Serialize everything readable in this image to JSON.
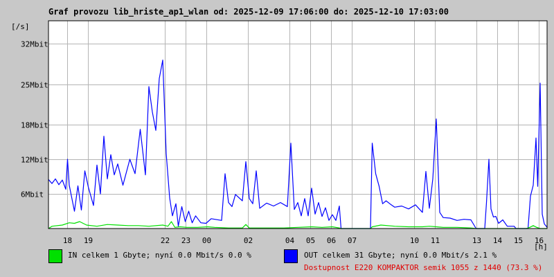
{
  "title": "Graf provozu lib_hriste_ap1_wlan od: 2025-12-09 17:06:00 do: 2025-12-10 17:03:00",
  "y_unit": "[/s]",
  "x_unit": "[h]",
  "colors": {
    "in": "#00e000",
    "out": "#0000ff",
    "grid": "#b4b4b4",
    "availability": "#e00000"
  },
  "legend": {
    "in_text": "IN celkem 1 Gbyte; nyní   0.0 Mbit/s 0.0 %",
    "out_text": "OUT celkem 31 Gbyte; nyní   0.0 Mbit/s 2.1 %"
  },
  "availability": "Dostupnost E220 KOMPAKTOR semik 1055 z 1440 (73.3 %)",
  "chart_data": {
    "type": "line",
    "y_unit": "Mbit/s",
    "ylim": [
      0,
      36
    ],
    "y_ticks": [
      {
        "value": 6,
        "label": "6Mbit"
      },
      {
        "value": 12,
        "label": "12Mbit"
      },
      {
        "value": 18,
        "label": "18Mbit"
      },
      {
        "value": 25,
        "label": "25Mbit"
      },
      {
        "value": 32,
        "label": "32Mbit"
      }
    ],
    "x_range_minutes": [
      0,
      1440
    ],
    "x_ticks": [
      {
        "t": 54,
        "label": "18"
      },
      {
        "t": 114,
        "label": "19"
      },
      {
        "t": 336,
        "label": "22"
      },
      {
        "t": 396,
        "label": "23"
      },
      {
        "t": 456,
        "label": "00"
      },
      {
        "t": 576,
        "label": "02"
      },
      {
        "t": 696,
        "label": "04"
      },
      {
        "t": 756,
        "label": "05"
      },
      {
        "t": 816,
        "label": "06"
      },
      {
        "t": 876,
        "label": "07"
      },
      {
        "t": 1056,
        "label": "10"
      },
      {
        "t": 1116,
        "label": "11"
      },
      {
        "t": 1236,
        "label": "13"
      },
      {
        "t": 1296,
        "label": "14"
      },
      {
        "t": 1356,
        "label": "15"
      },
      {
        "t": 1416,
        "label": "16"
      }
    ],
    "series": [
      {
        "name": "IN",
        "points": [
          [
            0,
            0
          ],
          [
            10,
            0.4
          ],
          [
            40,
            0.6
          ],
          [
            60,
            1.0
          ],
          [
            75,
            0.9
          ],
          [
            90,
            1.2
          ],
          [
            110,
            0.6
          ],
          [
            140,
            0.4
          ],
          [
            170,
            0.7
          ],
          [
            200,
            0.6
          ],
          [
            230,
            0.5
          ],
          [
            260,
            0.5
          ],
          [
            290,
            0.4
          ],
          [
            330,
            0.6
          ],
          [
            345,
            0.4
          ],
          [
            355,
            1.2
          ],
          [
            365,
            0.2
          ],
          [
            380,
            0.3
          ],
          [
            400,
            0.2
          ],
          [
            430,
            0.2
          ],
          [
            460,
            0.3
          ],
          [
            480,
            0.2
          ],
          [
            520,
            0.1
          ],
          [
            560,
            0.1
          ],
          [
            570,
            0.7
          ],
          [
            580,
            0.1
          ],
          [
            620,
            0.1
          ],
          [
            680,
            0.1
          ],
          [
            720,
            0.2
          ],
          [
            760,
            0.3
          ],
          [
            790,
            0.2
          ],
          [
            820,
            0.3
          ],
          [
            840,
            0.1
          ],
          [
            845,
            0
          ],
          [
            930,
            0
          ],
          [
            935,
            0.3
          ],
          [
            960,
            0.6
          ],
          [
            1000,
            0.4
          ],
          [
            1040,
            0.3
          ],
          [
            1080,
            0.3
          ],
          [
            1100,
            0.4
          ],
          [
            1120,
            0.3
          ],
          [
            1140,
            0.2
          ],
          [
            1180,
            0.2
          ],
          [
            1220,
            0.1
          ],
          [
            1235,
            0
          ],
          [
            1380,
            0
          ],
          [
            1390,
            0.2
          ],
          [
            1400,
            0.5
          ],
          [
            1410,
            0.2
          ],
          [
            1420,
            0
          ],
          [
            1440,
            0
          ]
        ]
      },
      {
        "name": "OUT",
        "points": [
          [
            0,
            8.5
          ],
          [
            10,
            7.8
          ],
          [
            20,
            8.6
          ],
          [
            30,
            7.6
          ],
          [
            40,
            8.4
          ],
          [
            50,
            6.8
          ],
          [
            55,
            12
          ],
          [
            60,
            7.5
          ],
          [
            75,
            3
          ],
          [
            85,
            7.4
          ],
          [
            95,
            3.2
          ],
          [
            105,
            10
          ],
          [
            115,
            7.2
          ],
          [
            130,
            4
          ],
          [
            140,
            11
          ],
          [
            150,
            6
          ],
          [
            160,
            16
          ],
          [
            170,
            8.6
          ],
          [
            180,
            12.8
          ],
          [
            190,
            9.3
          ],
          [
            200,
            11.2
          ],
          [
            215,
            7.5
          ],
          [
            235,
            12
          ],
          [
            250,
            9.5
          ],
          [
            265,
            17.2
          ],
          [
            280,
            9.3
          ],
          [
            290,
            24.6
          ],
          [
            300,
            20.2
          ],
          [
            310,
            17
          ],
          [
            320,
            26
          ],
          [
            330,
            29.2
          ],
          [
            340,
            13
          ],
          [
            350,
            5.3
          ],
          [
            358,
            2.2
          ],
          [
            368,
            4.3
          ],
          [
            375,
            0.4
          ],
          [
            385,
            3.8
          ],
          [
            395,
            1.2
          ],
          [
            405,
            3
          ],
          [
            415,
            1
          ],
          [
            425,
            2.2
          ],
          [
            440,
            1
          ],
          [
            455,
            0.9
          ],
          [
            470,
            1.7
          ],
          [
            500,
            1.4
          ],
          [
            510,
            9.5
          ],
          [
            520,
            4.5
          ],
          [
            530,
            3.8
          ],
          [
            540,
            5.9
          ],
          [
            560,
            4.8
          ],
          [
            570,
            11.6
          ],
          [
            580,
            5.2
          ],
          [
            590,
            4.3
          ],
          [
            600,
            10
          ],
          [
            610,
            3.5
          ],
          [
            630,
            4.4
          ],
          [
            650,
            3.9
          ],
          [
            670,
            4.5
          ],
          [
            690,
            3.8
          ],
          [
            700,
            14.8
          ],
          [
            710,
            3.3
          ],
          [
            720,
            4.5
          ],
          [
            730,
            2.2
          ],
          [
            740,
            5.2
          ],
          [
            750,
            2.2
          ],
          [
            760,
            7
          ],
          [
            770,
            2.5
          ],
          [
            780,
            4.5
          ],
          [
            790,
            2.1
          ],
          [
            800,
            3.6
          ],
          [
            810,
            1.4
          ],
          [
            820,
            2.4
          ],
          [
            830,
            1.4
          ],
          [
            840,
            3.9
          ],
          [
            845,
            0
          ],
          [
            930,
            0
          ],
          [
            935,
            14.8
          ],
          [
            945,
            9.5
          ],
          [
            955,
            7.3
          ],
          [
            965,
            4.3
          ],
          [
            975,
            4.8
          ],
          [
            990,
            4.1
          ],
          [
            1000,
            3.7
          ],
          [
            1020,
            3.9
          ],
          [
            1040,
            3.4
          ],
          [
            1060,
            4.1
          ],
          [
            1080,
            2.8
          ],
          [
            1090,
            9.9
          ],
          [
            1100,
            3.5
          ],
          [
            1110,
            8.6
          ],
          [
            1120,
            19
          ],
          [
            1130,
            2.8
          ],
          [
            1140,
            1.9
          ],
          [
            1160,
            1.8
          ],
          [
            1180,
            1.4
          ],
          [
            1200,
            1.6
          ],
          [
            1220,
            1.5
          ],
          [
            1235,
            0
          ],
          [
            1260,
            0
          ],
          [
            1265,
            4.5
          ],
          [
            1272,
            12
          ],
          [
            1278,
            3.4
          ],
          [
            1285,
            2
          ],
          [
            1292,
            2.1
          ],
          [
            1300,
            0.9
          ],
          [
            1312,
            1.5
          ],
          [
            1325,
            0.4
          ],
          [
            1345,
            0.4
          ],
          [
            1350,
            0
          ],
          [
            1385,
            0
          ],
          [
            1392,
            5.6
          ],
          [
            1400,
            7.5
          ],
          [
            1408,
            15.7
          ],
          [
            1413,
            7.3
          ],
          [
            1420,
            25.2
          ],
          [
            1426,
            2.5
          ],
          [
            1432,
            0.8
          ],
          [
            1440,
            0.2
          ]
        ]
      }
    ]
  }
}
